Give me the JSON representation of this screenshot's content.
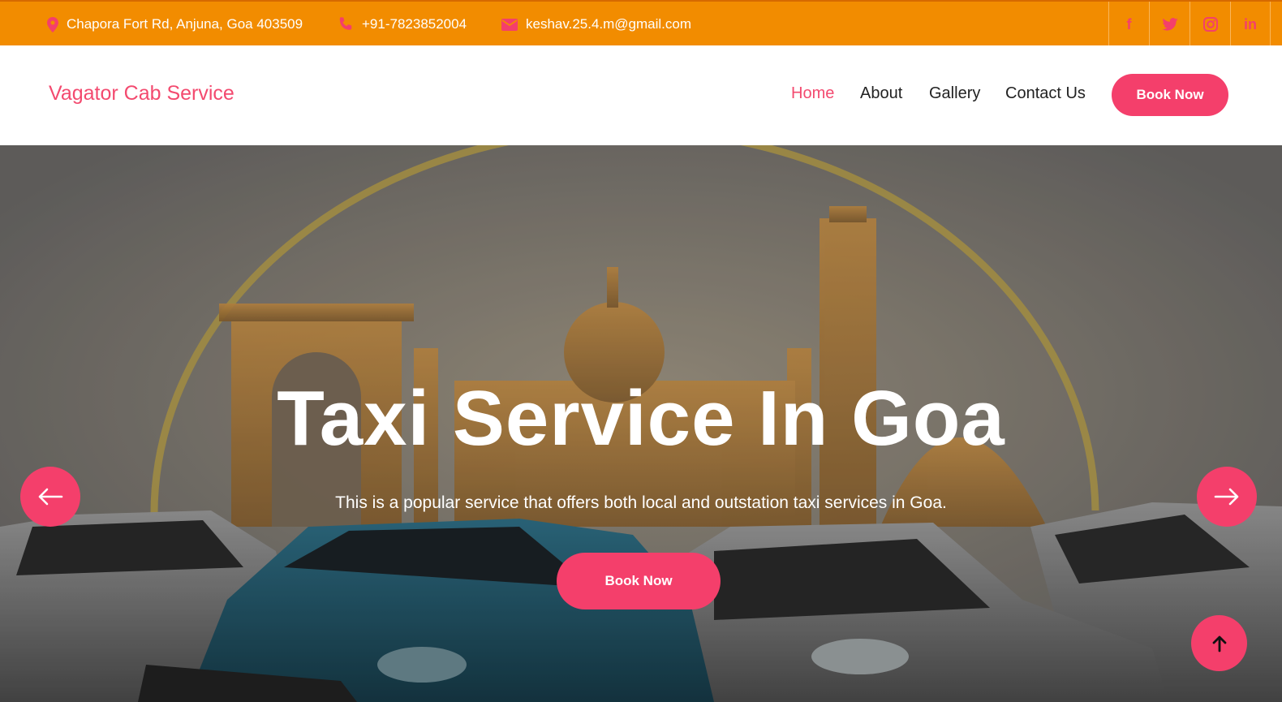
{
  "topbar": {
    "address": "Chapora Fort Rd, Anjuna, Goa 403509",
    "phone": "+91-7823852004",
    "email": "keshav.25.4.m@gmail.com",
    "social": [
      {
        "icon": "facebook-icon",
        "glyph": "f"
      },
      {
        "icon": "twitter-icon",
        "glyph": ""
      },
      {
        "icon": "instagram-icon",
        "glyph": ""
      },
      {
        "icon": "linkedin-icon",
        "glyph": "in"
      }
    ],
    "background_color": "#f28c00"
  },
  "navbar": {
    "brand": "Vagator Cab Service",
    "links": [
      {
        "label": "Home",
        "active": true
      },
      {
        "label": "About",
        "active": false
      },
      {
        "label": "Gallery",
        "active": false
      },
      {
        "label": "Contact Us",
        "active": false
      }
    ],
    "book_button": "Book Now"
  },
  "hero": {
    "title": "Taxi Service In Goa",
    "subtitle": "This is a popular service that offers both local and outstation taxi services in Goa.",
    "book_button": "Book Now",
    "prev_icon": "arrow-left-icon",
    "next_icon": "arrow-right-icon"
  },
  "back_to_top_icon": "arrow-up-icon",
  "colors": {
    "accent": "#f43f6b",
    "topbar": "#f28c00"
  }
}
